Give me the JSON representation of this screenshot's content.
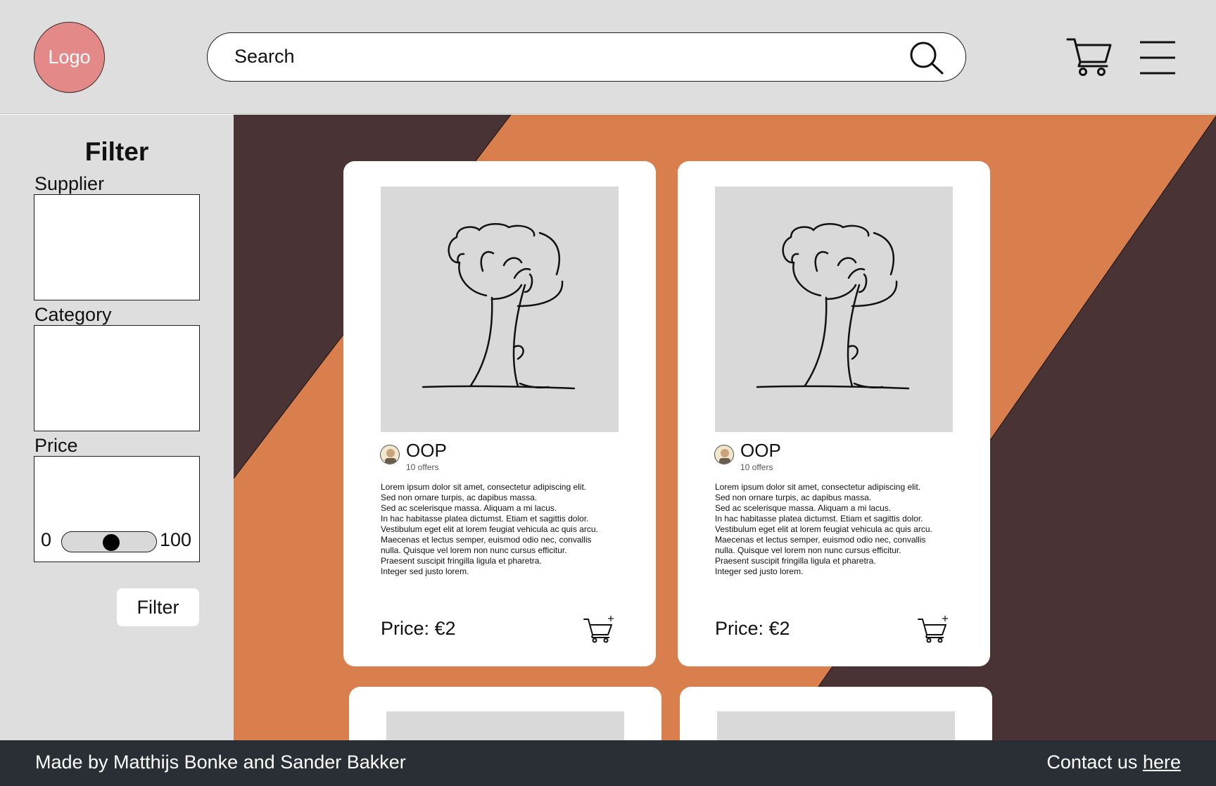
{
  "header": {
    "logo_text": "Logo",
    "search_placeholder": "Search",
    "search_icon": "search-icon",
    "cart_icon": "shopping-cart-icon",
    "menu_icon": "hamburger-menu-icon"
  },
  "sidebar": {
    "title": "Filter",
    "supplier_label": "Supplier",
    "category_label": "Category",
    "price_label": "Price",
    "price_min": "0",
    "price_max": "100",
    "price_slider_value_percent": 50,
    "filter_button_label": "Filter"
  },
  "products": [
    {
      "name": "OOP",
      "offers": "10 offers",
      "description": "Lorem ipsum dolor sit amet, consectetur adipiscing elit.\nSed non ornare turpis, ac dapibus massa.\nSed ac scelerisque massa. Aliquam a mi lacus.\nIn hac habitasse platea dictumst. Etiam et sagittis dolor.\nVestibulum eget elit at lorem feugiat vehicula ac quis arcu. Maecenas et lectus semper, euismod odio nec, convallis nulla. Quisque vel lorem non nunc cursus efficitur.\nPraesent suscipit fringilla ligula et pharetra.\nInteger sed justo lorem.",
      "price": "Price: €2",
      "image_icon": "tree-sketch-icon",
      "cart_icon": "add-to-cart-icon"
    },
    {
      "name": "OOP",
      "offers": "10 offers",
      "description": "Lorem ipsum dolor sit amet, consectetur adipiscing elit.\nSed non ornare turpis, ac dapibus massa.\nSed ac scelerisque massa. Aliquam a mi lacus.\nIn hac habitasse platea dictumst. Etiam et sagittis dolor.\nVestibulum eget elit at lorem feugiat vehicula ac quis arcu. Maecenas et lectus semper, euismod odio nec, convallis nulla. Quisque vel lorem non nunc cursus efficitur.\nPraesent suscipit fringilla ligula et pharetra.\nInteger sed justo lorem.",
      "price": "Price: €2",
      "image_icon": "tree-sketch-icon",
      "cart_icon": "add-to-cart-icon"
    }
  ],
  "footer": {
    "credit": "Made by Matthijs Bonke and Sander Bakker",
    "contact_prefix": "Contact us",
    "contact_link": "here"
  },
  "colors": {
    "header_bg": "#dedede",
    "logo_bg": "#e38a88",
    "main_dark": "#4a3334",
    "main_orange": "#d97f4e",
    "footer_bg": "#2a2e35",
    "card_bg": "#ffffff",
    "image_placeholder": "#d9d9d9"
  }
}
